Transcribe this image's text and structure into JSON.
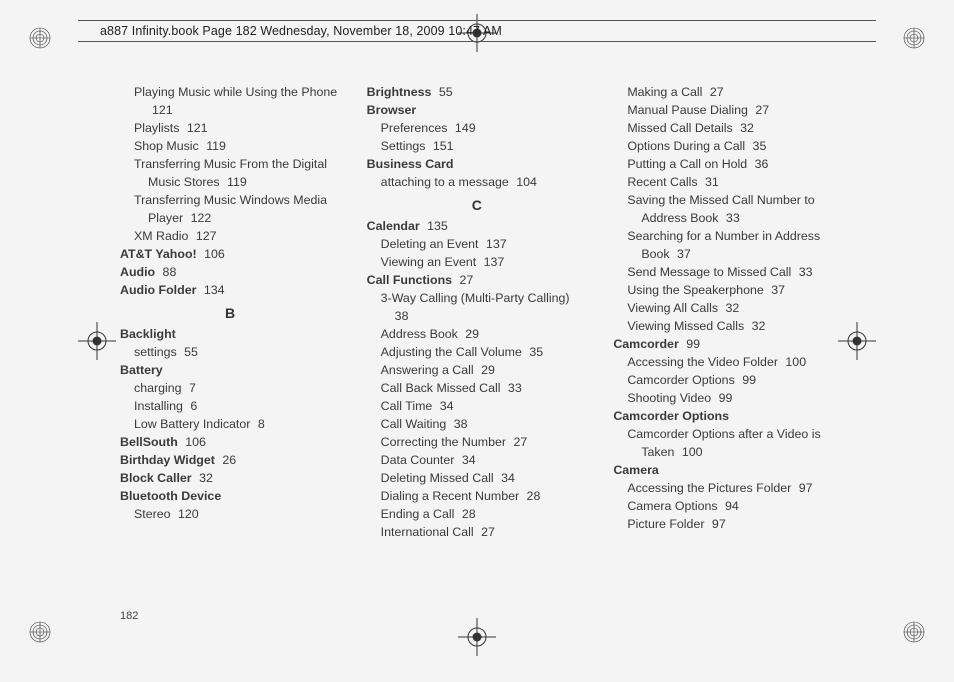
{
  "header": "a887 Infinity.book  Page 182  Wednesday, November 18, 2009  10:47 AM",
  "page_number": "182",
  "columns": [
    {
      "items": [
        {
          "type": "sub-wrap",
          "text": "Playing Music while Using the Phone",
          "page": "121"
        },
        {
          "type": "sub",
          "text": "Playlists",
          "page": "121"
        },
        {
          "type": "sub",
          "text": "Shop Music",
          "page": "119"
        },
        {
          "type": "sub-wrap",
          "text": "Transferring Music From the Digital Music Stores",
          "page": "119"
        },
        {
          "type": "sub-wrap",
          "text": "Transferring Music Windows Media Player",
          "page": "122"
        },
        {
          "type": "sub",
          "text": "XM Radio",
          "page": "127"
        },
        {
          "type": "head",
          "text": "AT&T Yahoo!",
          "page": "106"
        },
        {
          "type": "head",
          "text": "Audio",
          "page": "88"
        },
        {
          "type": "head",
          "text": "Audio Folder",
          "page": "134"
        },
        {
          "type": "letter",
          "text": "B"
        },
        {
          "type": "head",
          "text": "Backlight"
        },
        {
          "type": "sub",
          "text": "settings",
          "page": "55"
        },
        {
          "type": "head",
          "text": "Battery"
        },
        {
          "type": "sub",
          "text": "charging",
          "page": "7"
        },
        {
          "type": "sub",
          "text": "Installing",
          "page": "6"
        },
        {
          "type": "sub",
          "text": "Low Battery Indicator",
          "page": "8"
        },
        {
          "type": "head",
          "text": "BellSouth",
          "page": "106"
        },
        {
          "type": "head",
          "text": "Birthday Widget",
          "page": "26"
        },
        {
          "type": "head",
          "text": "Block Caller",
          "page": "32"
        },
        {
          "type": "head",
          "text": "Bluetooth Device"
        },
        {
          "type": "sub",
          "text": "Stereo",
          "page": "120"
        }
      ]
    },
    {
      "items": [
        {
          "type": "head",
          "text": "Brightness",
          "page": "55"
        },
        {
          "type": "head",
          "text": "Browser"
        },
        {
          "type": "sub",
          "text": "Preferences",
          "page": "149"
        },
        {
          "type": "sub",
          "text": "Settings",
          "page": "151"
        },
        {
          "type": "head",
          "text": "Business Card"
        },
        {
          "type": "sub",
          "text": "attaching to a message",
          "page": "104"
        },
        {
          "type": "letter",
          "text": "C"
        },
        {
          "type": "head",
          "text": "Calendar",
          "page": "135"
        },
        {
          "type": "sub",
          "text": "Deleting an Event",
          "page": "137"
        },
        {
          "type": "sub",
          "text": "Viewing an Event",
          "page": "137"
        },
        {
          "type": "head",
          "text": "Call Functions",
          "page": "27"
        },
        {
          "type": "sub-wrap",
          "text": "3-Way Calling (Multi-Party Calling)",
          "page": "38"
        },
        {
          "type": "sub",
          "text": "Address Book",
          "page": "29"
        },
        {
          "type": "sub",
          "text": "Adjusting the Call Volume",
          "page": "35"
        },
        {
          "type": "sub",
          "text": "Answering a Call",
          "page": "29"
        },
        {
          "type": "sub",
          "text": "Call Back Missed Call",
          "page": "33"
        },
        {
          "type": "sub",
          "text": "Call Time",
          "page": "34"
        },
        {
          "type": "sub",
          "text": "Call Waiting",
          "page": "38"
        },
        {
          "type": "sub",
          "text": "Correcting the Number",
          "page": "27"
        },
        {
          "type": "sub",
          "text": "Data Counter",
          "page": "34"
        },
        {
          "type": "sub",
          "text": "Deleting Missed Call",
          "page": "34"
        },
        {
          "type": "sub",
          "text": "Dialing a Recent Number",
          "page": "28"
        },
        {
          "type": "sub",
          "text": "Ending a Call",
          "page": "28"
        },
        {
          "type": "sub",
          "text": "International Call",
          "page": "27"
        }
      ]
    },
    {
      "items": [
        {
          "type": "sub",
          "text": "Making a Call",
          "page": "27"
        },
        {
          "type": "sub",
          "text": "Manual Pause Dialing",
          "page": "27"
        },
        {
          "type": "sub",
          "text": "Missed Call Details",
          "page": "32"
        },
        {
          "type": "sub",
          "text": "Options During a Call",
          "page": "35"
        },
        {
          "type": "sub",
          "text": "Putting a Call on Hold",
          "page": "36"
        },
        {
          "type": "sub",
          "text": "Recent Calls",
          "page": "31"
        },
        {
          "type": "sub-wrap",
          "text": "Saving the Missed Call Number to Address Book",
          "page": "33"
        },
        {
          "type": "sub-wrap",
          "text": "Searching for a Number in Address Book",
          "page": "37"
        },
        {
          "type": "sub",
          "text": "Send Message to Missed Call",
          "page": "33"
        },
        {
          "type": "sub",
          "text": "Using the Speakerphone",
          "page": "37"
        },
        {
          "type": "sub",
          "text": "Viewing All Calls",
          "page": "32"
        },
        {
          "type": "sub",
          "text": "Viewing Missed Calls",
          "page": "32"
        },
        {
          "type": "head",
          "text": "Camcorder",
          "page": "99"
        },
        {
          "type": "sub",
          "text": "Accessing the Video Folder",
          "page": "100"
        },
        {
          "type": "sub",
          "text": "Camcorder Options",
          "page": "99"
        },
        {
          "type": "sub",
          "text": "Shooting Video",
          "page": "99"
        },
        {
          "type": "head",
          "text": "Camcorder Options"
        },
        {
          "type": "sub-wrap",
          "text": "Camcorder Options after a Video is Taken",
          "page": "100"
        },
        {
          "type": "head",
          "text": "Camera"
        },
        {
          "type": "sub",
          "text": "Accessing the Pictures Folder",
          "page": "97"
        },
        {
          "type": "sub",
          "text": "Camera Options",
          "page": "94"
        },
        {
          "type": "sub",
          "text": "Picture Folder",
          "page": "97"
        }
      ]
    }
  ]
}
